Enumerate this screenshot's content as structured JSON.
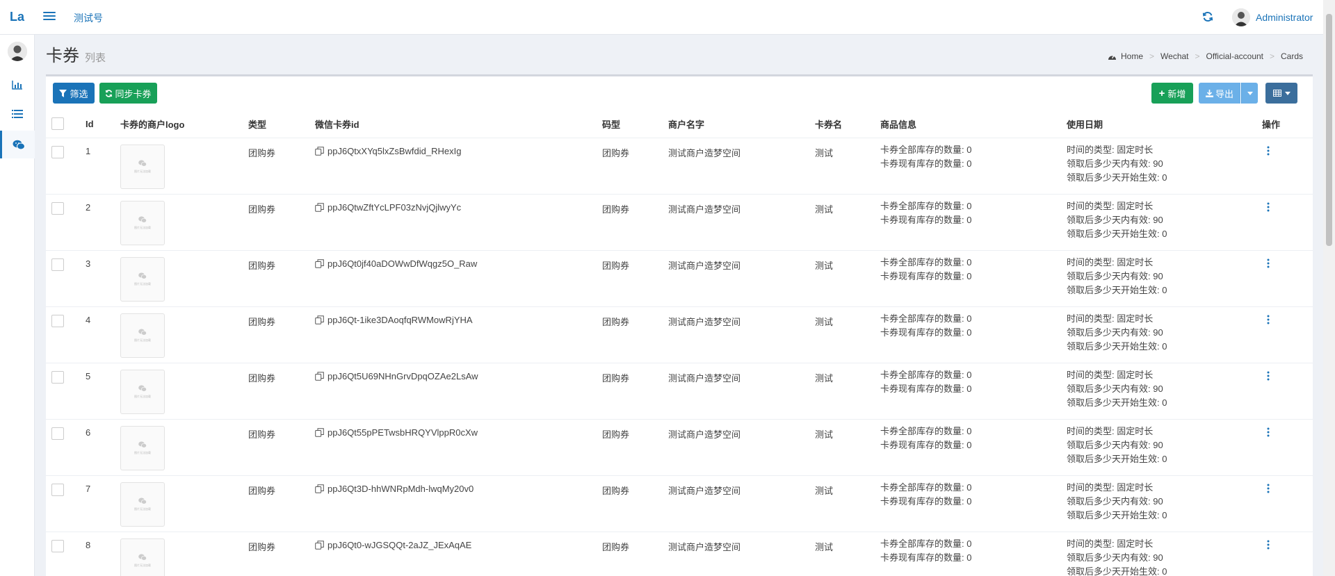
{
  "header": {
    "logo": "La",
    "link": "测试号",
    "user": "Administrator"
  },
  "page": {
    "title": "卡券",
    "subtitle": "列表"
  },
  "breadcrumb": [
    "Home",
    "Wechat",
    "Official-account",
    "Cards"
  ],
  "toolbar": {
    "filter_label": "筛选",
    "sync_label": "同步卡券",
    "add_label": "新增",
    "export_label": "导出"
  },
  "table": {
    "columns": [
      "Id",
      "卡券的商户logo",
      "类型",
      "微信卡券id",
      "码型",
      "商户名字",
      "卡券名",
      "商品信息",
      "使用日期",
      "操作"
    ],
    "logo_placeholder_text": "图片无法加载",
    "rows": [
      {
        "id": "1",
        "type": "团购券",
        "card_id": "ppJ6QtxXYq5lxZsBwfdid_RHexIg",
        "code_type": "团购券",
        "merchant": "测试商户造梦空间",
        "name": "测试",
        "stock_total": "卡券全部库存的数量: 0",
        "stock_current": "卡券现有库存的数量: 0",
        "date_type": "时间的类型: 固定时长",
        "valid_days": "领取后多少天内有效: 90",
        "begin_days": "领取后多少天开始生效: 0"
      },
      {
        "id": "2",
        "type": "团购券",
        "card_id": "ppJ6QtwZftYcLPF03zNvjQjlwyYc",
        "code_type": "团购券",
        "merchant": "测试商户造梦空间",
        "name": "测试",
        "stock_total": "卡券全部库存的数量: 0",
        "stock_current": "卡券现有库存的数量: 0",
        "date_type": "时间的类型: 固定时长",
        "valid_days": "领取后多少天内有效: 90",
        "begin_days": "领取后多少天开始生效: 0"
      },
      {
        "id": "3",
        "type": "团购券",
        "card_id": "ppJ6Qt0jf40aDOWwDfWqgz5O_Raw",
        "code_type": "团购券",
        "merchant": "测试商户造梦空间",
        "name": "测试",
        "stock_total": "卡券全部库存的数量: 0",
        "stock_current": "卡券现有库存的数量: 0",
        "date_type": "时间的类型: 固定时长",
        "valid_days": "领取后多少天内有效: 90",
        "begin_days": "领取后多少天开始生效: 0"
      },
      {
        "id": "4",
        "type": "团购券",
        "card_id": "ppJ6Qt-1ike3DAoqfqRWMowRjYHA",
        "code_type": "团购券",
        "merchant": "测试商户造梦空间",
        "name": "测试",
        "stock_total": "卡券全部库存的数量: 0",
        "stock_current": "卡券现有库存的数量: 0",
        "date_type": "时间的类型: 固定时长",
        "valid_days": "领取后多少天内有效: 90",
        "begin_days": "领取后多少天开始生效: 0"
      },
      {
        "id": "5",
        "type": "团购券",
        "card_id": "ppJ6Qt5U69NHnGrvDpqOZAe2LsAw",
        "code_type": "团购券",
        "merchant": "测试商户造梦空间",
        "name": "测试",
        "stock_total": "卡券全部库存的数量: 0",
        "stock_current": "卡券现有库存的数量: 0",
        "date_type": "时间的类型: 固定时长",
        "valid_days": "领取后多少天内有效: 90",
        "begin_days": "领取后多少天开始生效: 0"
      },
      {
        "id": "6",
        "type": "团购券",
        "card_id": "ppJ6Qt55pPETwsbHRQYVlppR0cXw",
        "code_type": "团购券",
        "merchant": "测试商户造梦空间",
        "name": "测试",
        "stock_total": "卡券全部库存的数量: 0",
        "stock_current": "卡券现有库存的数量: 0",
        "date_type": "时间的类型: 固定时长",
        "valid_days": "领取后多少天内有效: 90",
        "begin_days": "领取后多少天开始生效: 0"
      },
      {
        "id": "7",
        "type": "团购券",
        "card_id": "ppJ6Qt3D-hhWNRpMdh-lwqMy20v0",
        "code_type": "团购券",
        "merchant": "测试商户造梦空间",
        "name": "测试",
        "stock_total": "卡券全部库存的数量: 0",
        "stock_current": "卡券现有库存的数量: 0",
        "date_type": "时间的类型: 固定时长",
        "valid_days": "领取后多少天内有效: 90",
        "begin_days": "领取后多少天开始生效: 0"
      },
      {
        "id": "8",
        "type": "团购券",
        "card_id": "ppJ6Qt0-wJGSQQt-2aJZ_JExAqAE",
        "code_type": "团购券",
        "merchant": "测试商户造梦空间",
        "name": "测试",
        "stock_total": "卡券全部库存的数量: 0",
        "stock_current": "卡券现有库存的数量: 0",
        "date_type": "时间的类型: 固定时长",
        "valid_days": "领取后多少天内有效: 90",
        "begin_days": "领取后多少天开始生效: 0"
      }
    ]
  },
  "colors": {
    "primary": "#1a73b8",
    "success": "#18a058",
    "export": "#6bb0e8"
  }
}
